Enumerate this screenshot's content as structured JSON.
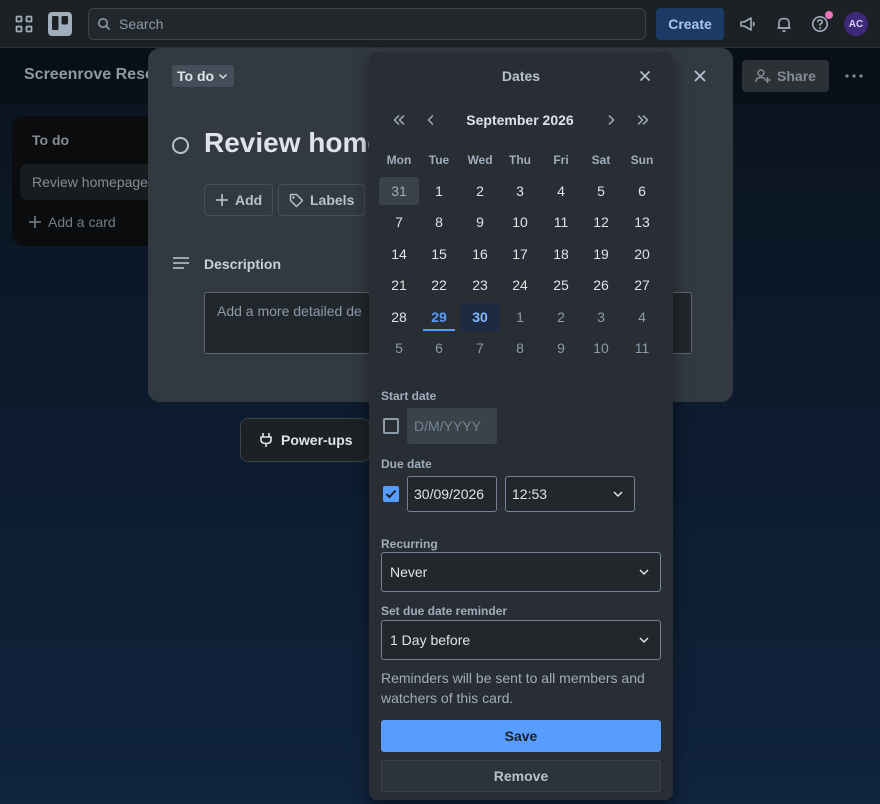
{
  "topbar": {
    "search_placeholder": "Search",
    "create_label": "Create",
    "avatar_initials": "AC"
  },
  "board": {
    "title": "Screenrove Rese",
    "share_label": "Share"
  },
  "list": {
    "title": "To do",
    "card_text": "Review homepage",
    "add_card_label": "Add a card"
  },
  "card_modal": {
    "list_name": "To do",
    "title": "Review home",
    "add_label": "Add",
    "labels_label": "Labels",
    "description_label": "Description",
    "description_placeholder": "Add a more detailed de",
    "powerups_label": "Power-ups"
  },
  "dates_popover": {
    "title": "Dates",
    "month_label": "September 2026",
    "weekdays": [
      "Mon",
      "Tue",
      "Wed",
      "Thu",
      "Fri",
      "Sat",
      "Sun"
    ],
    "weeks": [
      [
        "31",
        "1",
        "2",
        "3",
        "4",
        "5",
        "6"
      ],
      [
        "7",
        "8",
        "9",
        "10",
        "11",
        "12",
        "13"
      ],
      [
        "14",
        "15",
        "16",
        "17",
        "18",
        "19",
        "20"
      ],
      [
        "21",
        "22",
        "23",
        "24",
        "25",
        "26",
        "27"
      ],
      [
        "28",
        "29",
        "30",
        "1",
        "2",
        "3",
        "4"
      ],
      [
        "5",
        "6",
        "7",
        "8",
        "9",
        "10",
        "11"
      ]
    ],
    "today": "29",
    "selected": "30",
    "start_date": {
      "label": "Start date",
      "placeholder": "D/M/YYYY",
      "checked": false
    },
    "due_date": {
      "label": "Due date",
      "date_value": "30/09/2026",
      "time_value": "12:53",
      "checked": true
    },
    "recurring": {
      "label": "Recurring",
      "value": "Never"
    },
    "reminder": {
      "label": "Set due date reminder",
      "value": "1 Day before",
      "note": "Reminders will be sent to all members and watchers of this card."
    },
    "save_label": "Save",
    "remove_label": "Remove"
  },
  "colors": {
    "accent": "#579dff",
    "popover_bg": "#282e33",
    "modal_bg": "#323940",
    "topbar_bg": "#1d2125"
  }
}
